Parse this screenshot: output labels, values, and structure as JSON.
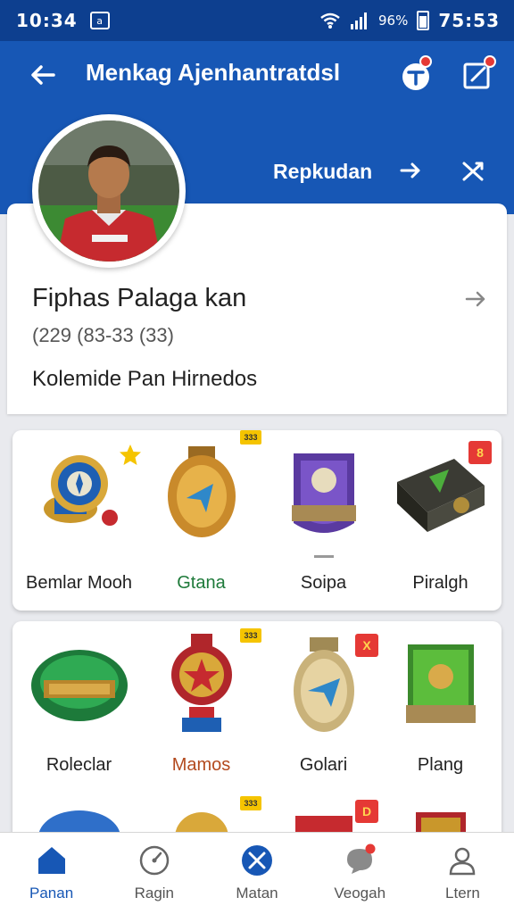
{
  "status_bar": {
    "time": "10:34",
    "notification_glyph": "a",
    "battery_percent": "96%",
    "time_right": "75:53"
  },
  "header": {
    "title": "Menkag Ajenhantratdsl",
    "action_label": "Repkudan"
  },
  "profile": {
    "name": "Fiphas Palaga kan",
    "number": "(229  (83-33 (33)",
    "description": "Kolemide Pan Hirnedos"
  },
  "grid_row_1": [
    {
      "label": "Bemlar Mooh",
      "label_color": "#222222",
      "badge": "star"
    },
    {
      "label": "Gtana",
      "label_color": "#1e7a3a",
      "badge": "333"
    },
    {
      "label": "Soipa",
      "label_color": "#222222",
      "badge": ""
    },
    {
      "label": "Piralgh",
      "label_color": "#222222",
      "badge": "8"
    }
  ],
  "grid_row_2": [
    {
      "label": "Roleclar",
      "label_color": "#222222",
      "badge": ""
    },
    {
      "label": "Mamos",
      "label_color": "#b34a1e",
      "badge": "333"
    },
    {
      "label": "Golari",
      "label_color": "#222222",
      "badge": "X"
    },
    {
      "label": "Plang",
      "label_color": "#222222",
      "badge": ""
    }
  ],
  "grid_row_3_badges": [
    "333",
    "D"
  ],
  "bottom_nav": [
    {
      "label": "Panan",
      "icon": "home-icon",
      "active": true
    },
    {
      "label": "Ragin",
      "icon": "gauge-icon",
      "active": false
    },
    {
      "label": "Matan",
      "icon": "tools-icon",
      "active": false
    },
    {
      "label": "Veogah",
      "icon": "chat-icon",
      "active": false
    },
    {
      "label": "Ltern",
      "icon": "user-icon",
      "active": false
    }
  ],
  "colors": {
    "header_blue": "#1757b5",
    "status_blue": "#0d3f8f",
    "accent_red": "#e53935"
  }
}
